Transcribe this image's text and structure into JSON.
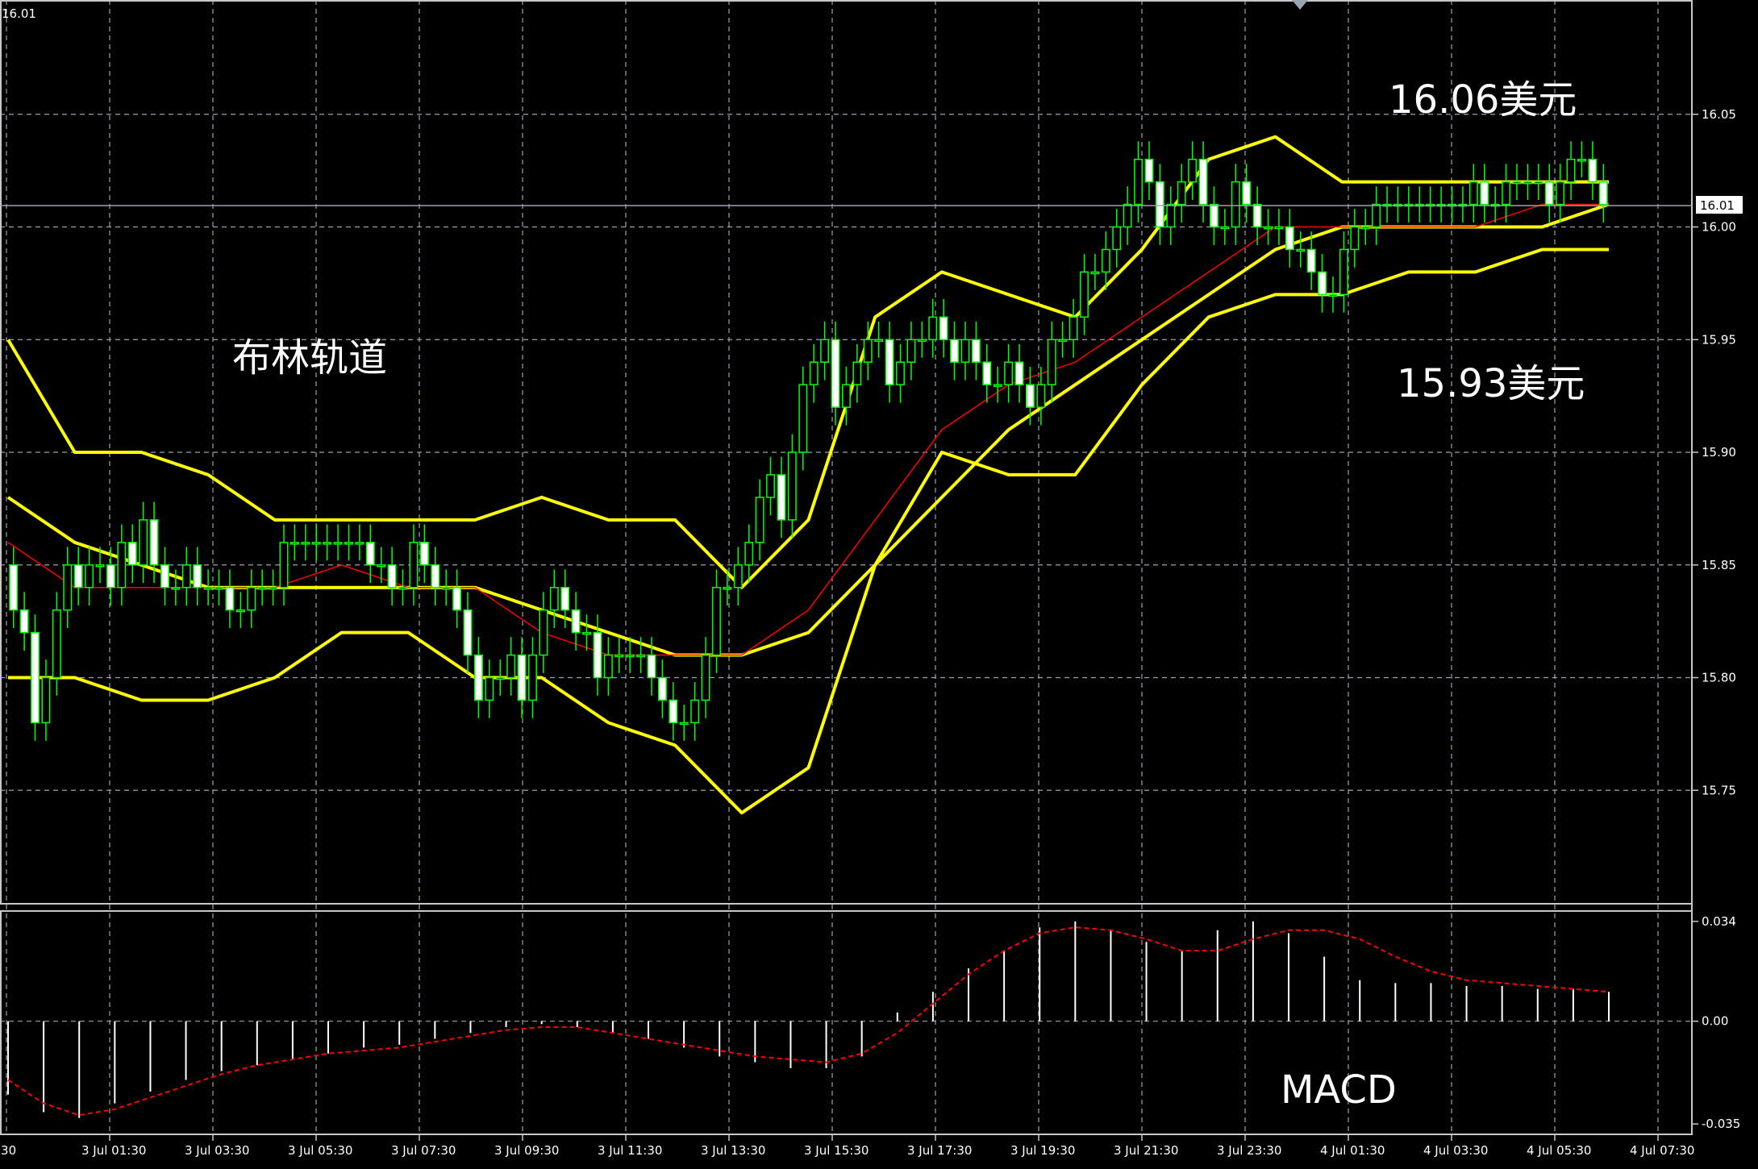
{
  "annotations": {
    "top_left_price": "16.01",
    "bollinger_label": "布林轨道",
    "upper_price_label": "16.06美元",
    "lower_price_label": "15.93美元",
    "macd_label": "MACD"
  },
  "colors": {
    "background": "#000000",
    "grid": "#9aa3b0",
    "candle": "#00ff00",
    "bollinger": "#ffff00",
    "moving_average": "#ff0000",
    "macd_histogram": "#ffffff",
    "macd_signal": "#ff0000",
    "text": "#ffffff"
  },
  "chart_data": [
    {
      "type": "candlestick",
      "title": "",
      "price_axis_ticks": [
        16.05,
        16.0,
        15.95,
        15.9,
        15.85,
        15.8,
        15.75
      ],
      "ylim": [
        15.7,
        16.1
      ],
      "current_price": "16.01",
      "time_axis_labels": [
        "3 Jul 01:30",
        "3 Jul 03:30",
        "3 Jul 05:30",
        "3 Jul 07:30",
        "3 Jul 09:30",
        "3 Jul 11:30",
        "3 Jul 13:30",
        "3 Jul 15:30",
        "3 Jul 17:30",
        "3 Jul 19:30",
        "3 Jul 21:30",
        "3 Jul 23:30",
        "4 Jul 01:30",
        "4 Jul 03:30",
        "4 Jul 05:30",
        "4 Jul 07:30"
      ],
      "first_axis_label_partial": ":30",
      "grid": true,
      "closes": [
        15.83,
        15.82,
        15.78,
        15.8,
        15.83,
        15.85,
        15.84,
        15.85,
        15.85,
        15.84,
        15.86,
        15.85,
        15.87,
        15.85,
        15.84,
        15.84,
        15.85,
        15.84,
        15.84,
        15.84,
        15.83,
        15.83,
        15.84,
        15.84,
        15.84,
        15.86,
        15.86,
        15.86,
        15.86,
        15.86,
        15.86,
        15.86,
        15.86,
        15.85,
        15.85,
        15.84,
        15.84,
        15.86,
        15.85,
        15.84,
        15.84,
        15.83,
        15.81,
        15.79,
        15.8,
        15.8,
        15.81,
        15.79,
        15.81,
        15.83,
        15.84,
        15.83,
        15.82,
        15.82,
        15.8,
        15.81,
        15.81,
        15.81,
        15.81,
        15.8,
        15.79,
        15.78,
        15.78,
        15.79,
        15.81,
        15.84,
        15.84,
        15.85,
        15.86,
        15.88,
        15.89,
        15.87,
        15.9,
        15.93,
        15.94,
        15.95,
        15.92,
        15.93,
        15.94,
        15.95,
        15.95,
        15.93,
        15.94,
        15.95,
        15.95,
        15.96,
        15.95,
        15.94,
        15.95,
        15.94,
        15.93,
        15.93,
        15.94,
        15.93,
        15.92,
        15.93,
        15.95,
        15.95,
        15.96,
        15.98,
        15.98,
        15.99,
        16.0,
        16.01,
        16.03,
        16.02,
        16.0,
        16.01,
        16.02,
        16.03,
        16.01,
        16.0,
        16.0,
        16.02,
        16.01,
        16.0,
        16.0,
        16.0,
        15.99,
        15.99,
        15.98,
        15.97,
        15.97,
        15.99,
        16.0,
        16.0,
        16.01,
        16.01,
        16.01,
        16.01,
        16.01,
        16.01,
        16.01,
        16.01,
        16.01,
        16.02,
        16.01,
        16.01,
        16.02,
        16.02,
        16.02,
        16.02,
        16.01,
        16.02,
        16.03,
        16.03,
        16.02,
        16.01
      ],
      "bollinger_upper": [
        15.95,
        15.9,
        15.9,
        15.89,
        15.87,
        15.87,
        15.87,
        15.87,
        15.88,
        15.87,
        15.87,
        15.84,
        15.87,
        15.96,
        15.98,
        15.97,
        15.96,
        15.99,
        16.03,
        16.04,
        16.02,
        16.02,
        16.02,
        16.02,
        16.02
      ],
      "bollinger_middle": [
        15.88,
        15.86,
        15.85,
        15.84,
        15.84,
        15.84,
        15.84,
        15.84,
        15.83,
        15.82,
        15.81,
        15.81,
        15.82,
        15.85,
        15.88,
        15.91,
        15.93,
        15.95,
        15.97,
        15.99,
        16.0,
        16.0,
        16.0,
        16.0,
        16.01
      ],
      "bollinger_lower": [
        15.8,
        15.8,
        15.79,
        15.79,
        15.8,
        15.82,
        15.82,
        15.8,
        15.8,
        15.78,
        15.77,
        15.74,
        15.76,
        15.85,
        15.9,
        15.89,
        15.89,
        15.93,
        15.96,
        15.97,
        15.97,
        15.98,
        15.98,
        15.99,
        15.99
      ],
      "moving_average": [
        15.86,
        15.84,
        15.84,
        15.84,
        15.84,
        15.85,
        15.84,
        15.84,
        15.82,
        15.81,
        15.81,
        15.81,
        15.83,
        15.87,
        15.91,
        15.93,
        15.94,
        15.96,
        15.98,
        16.0,
        16.0,
        16.0,
        16.0,
        16.01,
        16.01
      ]
    },
    {
      "type": "macd",
      "title": "",
      "ticks": [
        0.034,
        0.0,
        -0.035
      ],
      "tick_labels": [
        "0.034",
        "0.00",
        "-0.035"
      ],
      "ylim": [
        -0.038,
        0.037
      ],
      "histogram": [
        -0.025,
        -0.031,
        -0.033,
        -0.028,
        -0.024,
        -0.02,
        -0.017,
        -0.015,
        -0.013,
        -0.011,
        -0.009,
        -0.008,
        -0.006,
        -0.004,
        -0.002,
        -0.001,
        -0.002,
        -0.004,
        -0.006,
        -0.009,
        -0.012,
        -0.014,
        -0.016,
        -0.016,
        -0.012,
        0.003,
        0.01,
        0.018,
        0.024,
        0.032,
        0.034,
        0.031,
        0.027,
        0.024,
        0.031,
        0.034,
        0.03,
        0.022,
        0.014,
        0.013,
        0.013,
        0.012,
        0.012,
        0.011,
        0.011,
        0.01
      ],
      "signal": [
        -0.02,
        -0.028,
        -0.032,
        -0.03,
        -0.026,
        -0.022,
        -0.018,
        -0.015,
        -0.013,
        -0.011,
        -0.01,
        -0.009,
        -0.007,
        -0.005,
        -0.003,
        -0.002,
        -0.002,
        -0.004,
        -0.006,
        -0.008,
        -0.01,
        -0.012,
        -0.013,
        -0.014,
        -0.011,
        -0.004,
        0.006,
        0.016,
        0.024,
        0.03,
        0.032,
        0.031,
        0.028,
        0.024,
        0.024,
        0.028,
        0.031,
        0.031,
        0.028,
        0.022,
        0.017,
        0.014,
        0.013,
        0.012,
        0.011,
        0.01
      ]
    }
  ]
}
